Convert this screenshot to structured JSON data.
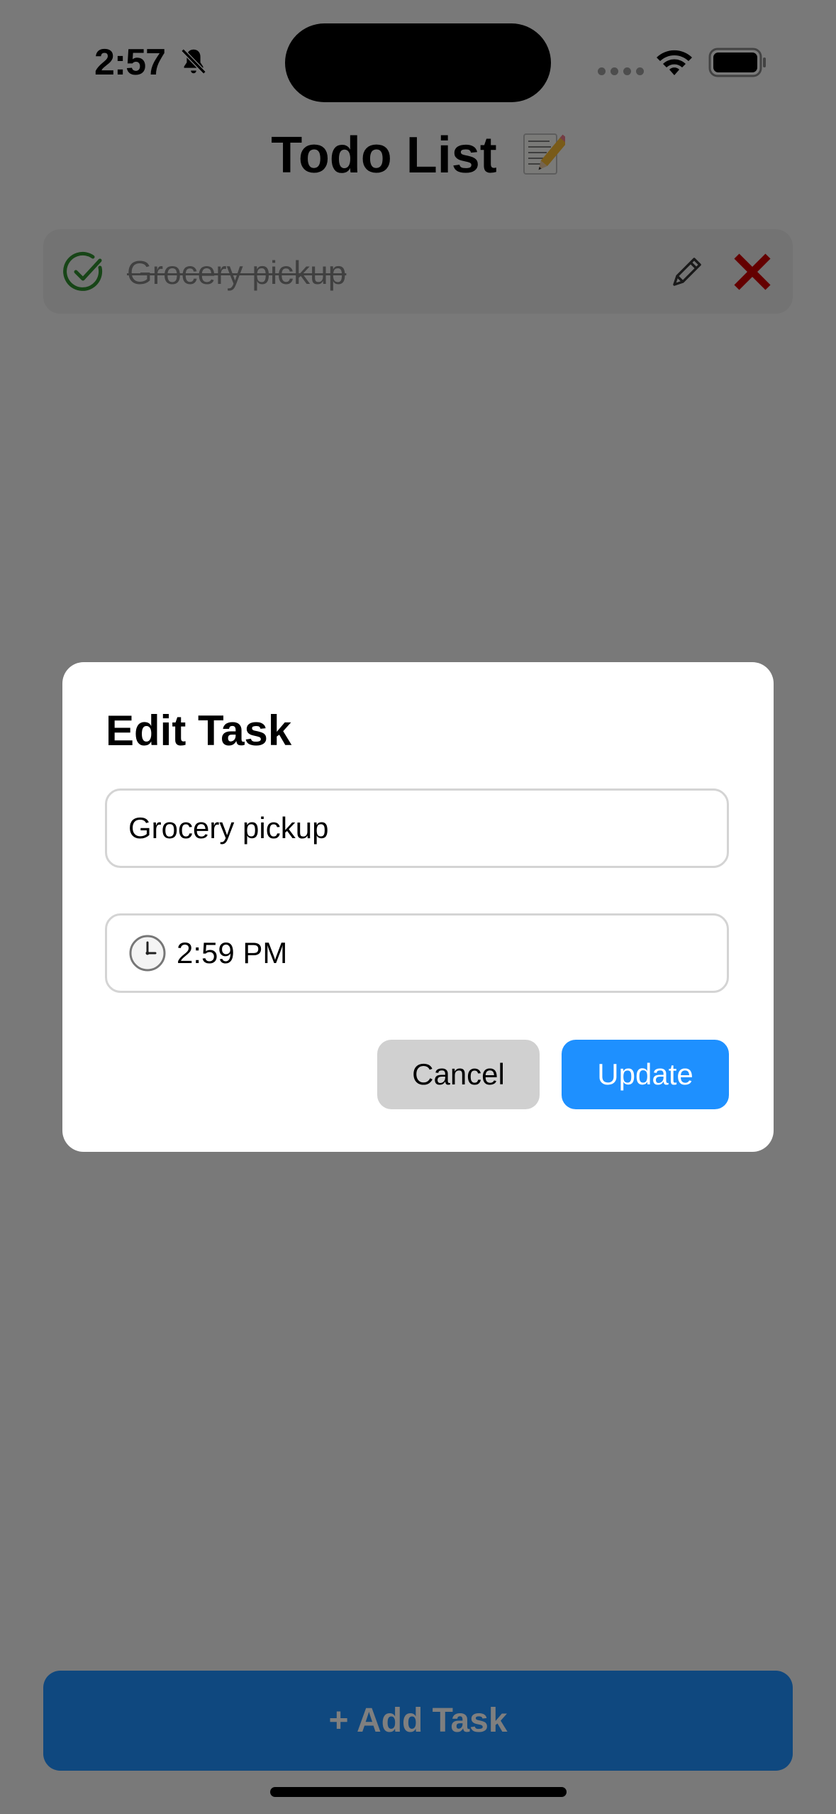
{
  "status_bar": {
    "time": "2:57"
  },
  "header": {
    "title": "Todo List"
  },
  "tasks": [
    {
      "text": "Grocery pickup",
      "completed": true
    }
  ],
  "add_button": {
    "label": "+ Add Task"
  },
  "modal": {
    "title": "Edit Task",
    "task_value": "Grocery pickup",
    "time_value": "2:59 PM",
    "cancel_label": "Cancel",
    "update_label": "Update"
  },
  "colors": {
    "accent": "#1e90ff",
    "complete": "#2e8b2e",
    "delete": "#c80000",
    "overlay": "rgba(0,0,0,0.5)"
  },
  "icons": [
    "bell-slash-icon",
    "wifi-icon",
    "battery-icon",
    "memo-pencil-icon",
    "check-circle-icon",
    "pencil-icon",
    "close-x-icon",
    "clock-icon"
  ]
}
